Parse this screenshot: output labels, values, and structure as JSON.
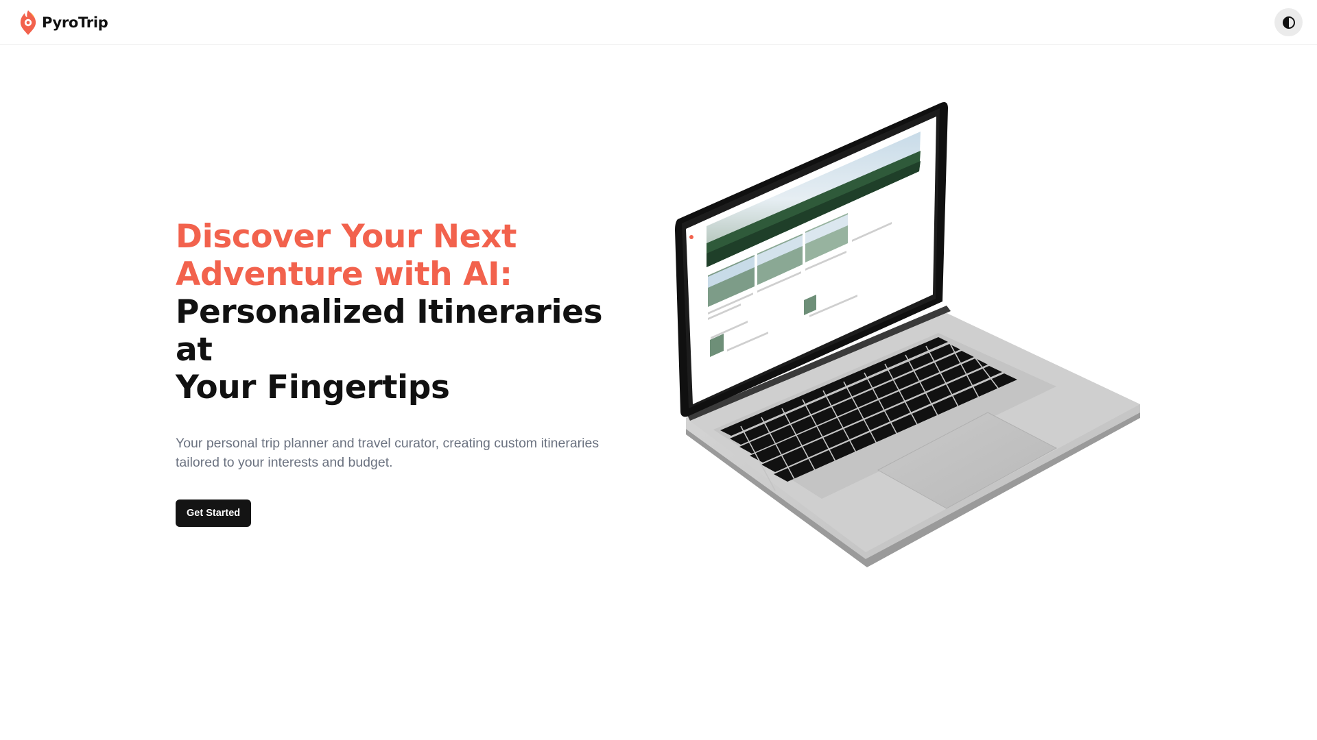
{
  "header": {
    "brand_name": "PyroTrip",
    "logo_icon": "flame-pin-logo",
    "theme_toggle_icon": "contrast-icon"
  },
  "hero": {
    "title_accent_line1": "Discover Your Next",
    "title_accent_line2": "Adventure with AI:",
    "title_dark_line1": "Personalized Itineraries at",
    "title_dark_line2": "Your Fingertips",
    "subtitle": "Your personal trip planner and travel curator, creating custom itineraries tailored to your interests and budget.",
    "cta_label": "Get Started"
  },
  "colors": {
    "accent": "#f2624d",
    "text_dark": "#111111",
    "subtitle": "#6b7280",
    "button_bg": "#141414",
    "toggle_bg": "#ebebeb"
  }
}
